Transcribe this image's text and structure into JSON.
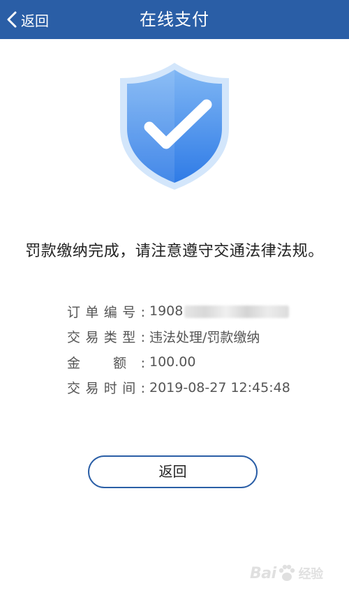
{
  "header": {
    "back_label": "返回",
    "title": "在线支付"
  },
  "message": "罚款缴纳完成，请注意遵守交通法律法规。",
  "details": [
    {
      "label": "订单编号:",
      "value": "1908"
    },
    {
      "label": "交易类型:",
      "value": "违法处理/罚款缴纳"
    },
    {
      "label": "金 额:",
      "value": "100.00"
    },
    {
      "label": "交易时间:",
      "value": "2019-08-27 12:45:48"
    }
  ],
  "return_button": "返回",
  "watermark": {
    "text": "Bai",
    "paw_text": "经验"
  },
  "colors": {
    "header": "#2a5ea6",
    "shield_light": "#cfe3fb",
    "shield_dark": "#3f86e6",
    "button_border": "#2a5ea6"
  }
}
